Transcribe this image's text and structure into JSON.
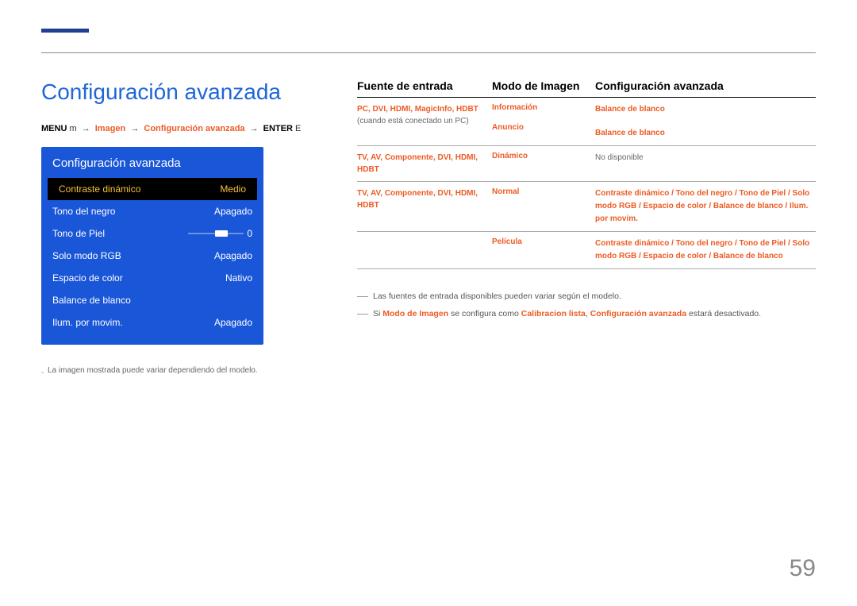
{
  "page": {
    "title": "Configuración avanzada",
    "number": "59"
  },
  "breadcrumb": {
    "menu": "MENU",
    "m": "m",
    "s1": "Imagen",
    "s2": "Configuración avanzada",
    "enter": "ENTER",
    "e": "E",
    "arrow": "→"
  },
  "osd": {
    "title": "Configuración avanzada",
    "rows": [
      {
        "label": "Contraste dinámico",
        "value": "Medio",
        "selected": true
      },
      {
        "label": "Tono del negro",
        "value": "Apagado"
      },
      {
        "label": "Tono de Piel",
        "value": "0",
        "slider": true
      },
      {
        "label": "Solo modo RGB",
        "value": "Apagado"
      },
      {
        "label": "Espacio de color",
        "value": "Nativo"
      },
      {
        "label": "Balance de blanco",
        "value": ""
      },
      {
        "label": "Ilum. por movim.",
        "value": "Apagado"
      }
    ],
    "note": "La imagen mostrada puede variar dependiendo del modelo."
  },
  "table": {
    "head": {
      "c1": "Fuente de entrada",
      "c2": "Modo de Imagen",
      "c3": "Configuración avanzada"
    },
    "rows": [
      {
        "c1": "PC, DVI, HDMI, MagicInfo, HDBT",
        "c1_suffix": " (cuando está conectado un PC)",
        "c2a": "Información",
        "c2b": "Anuncio",
        "c3a": "Balance de blanco",
        "c3b": "Balance de blanco"
      },
      {
        "c1": "TV, AV, Componente, DVI, HDMI, HDBT",
        "c2": "Dinámico",
        "c3": "No disponible",
        "c3plain": true
      },
      {
        "c1": "TV, AV, Componente, DVI, HDMI, HDBT",
        "c2": "Normal",
        "c3": "Contraste dinámico / Tono del negro / Tono de Piel / Solo modo RGB / Espacio de color / Balance de blanco / Ilum. por movim."
      },
      {
        "c1": "",
        "c2": "Película",
        "c3": "Contraste dinámico / Tono del negro / Tono de Piel / Solo modo RGB / Espacio de color / Balance de blanco"
      }
    ]
  },
  "notes": {
    "n1": "Las fuentes de entrada disponibles pueden variar según el modelo.",
    "n2_a": "Si ",
    "n2_b": "Modo de Imagen",
    "n2_c": " se configura como ",
    "n2_d": "Calibracion lista",
    "n2_sep": ", ",
    "n2_e": "Configuración avanzada",
    "n2_f": " estará desactivado."
  }
}
